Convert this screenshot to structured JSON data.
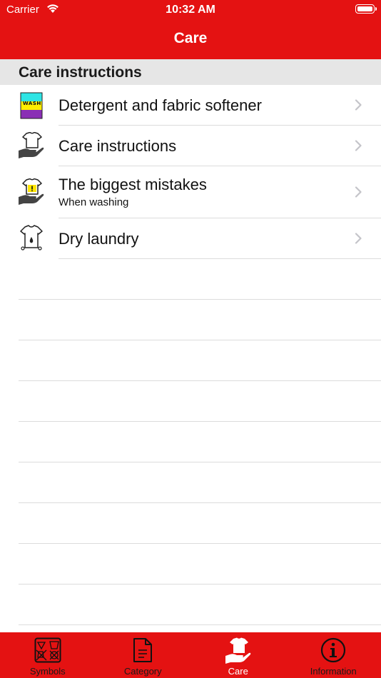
{
  "status_bar": {
    "carrier": "Carrier",
    "time": "10:32 AM"
  },
  "nav": {
    "title": "Care"
  },
  "section": {
    "header": "Care instructions"
  },
  "rows": [
    {
      "title": "Detergent and fabric softener",
      "icon": "wash-detergent-icon",
      "icon_text": "WASH"
    },
    {
      "title": "Care instructions",
      "icon": "hand-shirt-icon"
    },
    {
      "title": "The biggest mistakes",
      "subtitle": "When washing",
      "icon": "hand-shirt-warning-icon"
    },
    {
      "title": "Dry laundry",
      "icon": "shirt-drying-icon"
    }
  ],
  "tabs": [
    {
      "label": "Symbols",
      "icon": "laundry-symbols-icon",
      "selected": false
    },
    {
      "label": "Category",
      "icon": "document-icon",
      "selected": false
    },
    {
      "label": "Care",
      "icon": "hand-shirt-icon",
      "selected": true
    },
    {
      "label": "Information",
      "icon": "info-icon",
      "selected": false
    }
  ],
  "colors": {
    "accent": "#e41212",
    "section_bg": "#e6e6e6",
    "separator": "#dcdcdc"
  }
}
